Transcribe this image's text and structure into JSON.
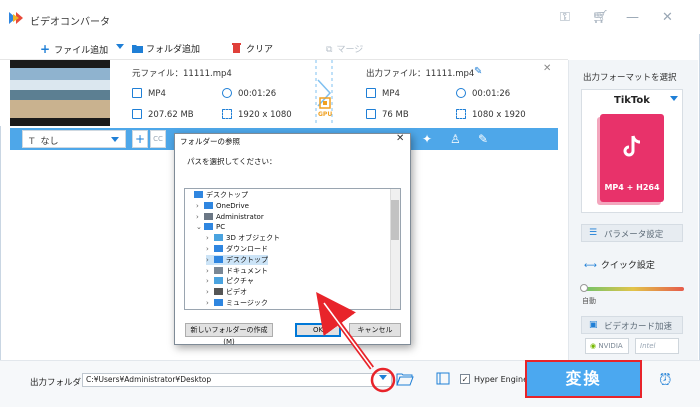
{
  "app": {
    "title": "ビデオコンバータ"
  },
  "toolbar": {
    "add_file": "ファイル追加",
    "add_folder": "フォルダ追加",
    "clear": "クリア",
    "merge": "マージ"
  },
  "file": {
    "source_label": "元ファイル：11111.mp4",
    "source_format": "MP4",
    "source_duration": "00:01:26",
    "source_size": "207.62 MB",
    "source_resolution": "1920 x 1080",
    "gpu_label": "GPU",
    "output_label": "出力ファイル：11111.mp4",
    "output_format": "MP4",
    "output_duration": "00:01:26",
    "output_size": "76 MB",
    "output_resolution": "1080 x 1920"
  },
  "editbar": {
    "subtitle_value": "なし",
    "cc_label": "CC"
  },
  "panel": {
    "format_label": "出力フォーマットを選択",
    "format_name": "TikTok",
    "format_tile_text": "MP4 + H264",
    "param_button": "パラメータ設定",
    "quick_label": "クイック設定",
    "slider_label": "自動",
    "gpu_button": "ビデオカード加速",
    "vendor_nvidia": "NVIDIA",
    "vendor_intel": "Intel"
  },
  "bottom": {
    "output_folder_label": "出力フォルダ：",
    "output_path": "C:¥Users¥Administrator¥Desktop",
    "hw_label": "Hyper Engine",
    "hw_checked": "✓",
    "convert_label": "変換"
  },
  "dialog": {
    "title": "フォルダーの参照",
    "message": "パスを選択してください：",
    "tree": [
      {
        "label": "デスクトップ",
        "indent": 0,
        "expander": "",
        "icon": "desktop"
      },
      {
        "label": "OneDrive",
        "indent": 1,
        "expander": "›",
        "icon": "cloud"
      },
      {
        "label": "Administrator",
        "indent": 1,
        "expander": "›",
        "icon": "user"
      },
      {
        "label": "PC",
        "indent": 1,
        "expander": "⌄",
        "icon": "pc"
      },
      {
        "label": "3D オブジェクト",
        "indent": 2,
        "expander": "›",
        "icon": "cube"
      },
      {
        "label": "ダウンロード",
        "indent": 2,
        "expander": "›",
        "icon": "download"
      },
      {
        "label": "デスクトップ",
        "indent": 2,
        "expander": "›",
        "icon": "desktop",
        "selected": true
      },
      {
        "label": "ドキュメント",
        "indent": 2,
        "expander": "›",
        "icon": "doc"
      },
      {
        "label": "ピクチャ",
        "indent": 2,
        "expander": "›",
        "icon": "pic"
      },
      {
        "label": "ビデオ",
        "indent": 2,
        "expander": "›",
        "icon": "video"
      },
      {
        "label": "ミュージック",
        "indent": 2,
        "expander": "›",
        "icon": "music"
      }
    ],
    "new_folder_button": "新しいフォルダーの作成(M)",
    "ok_button": "OK",
    "cancel_button": "キャンセル"
  },
  "colors": {
    "accent": "#1f7fd6",
    "editbar": "#4ea7e9",
    "convert": "#4ba8f0",
    "highlight": "#e8242a",
    "tiktok": "#e8326a"
  }
}
